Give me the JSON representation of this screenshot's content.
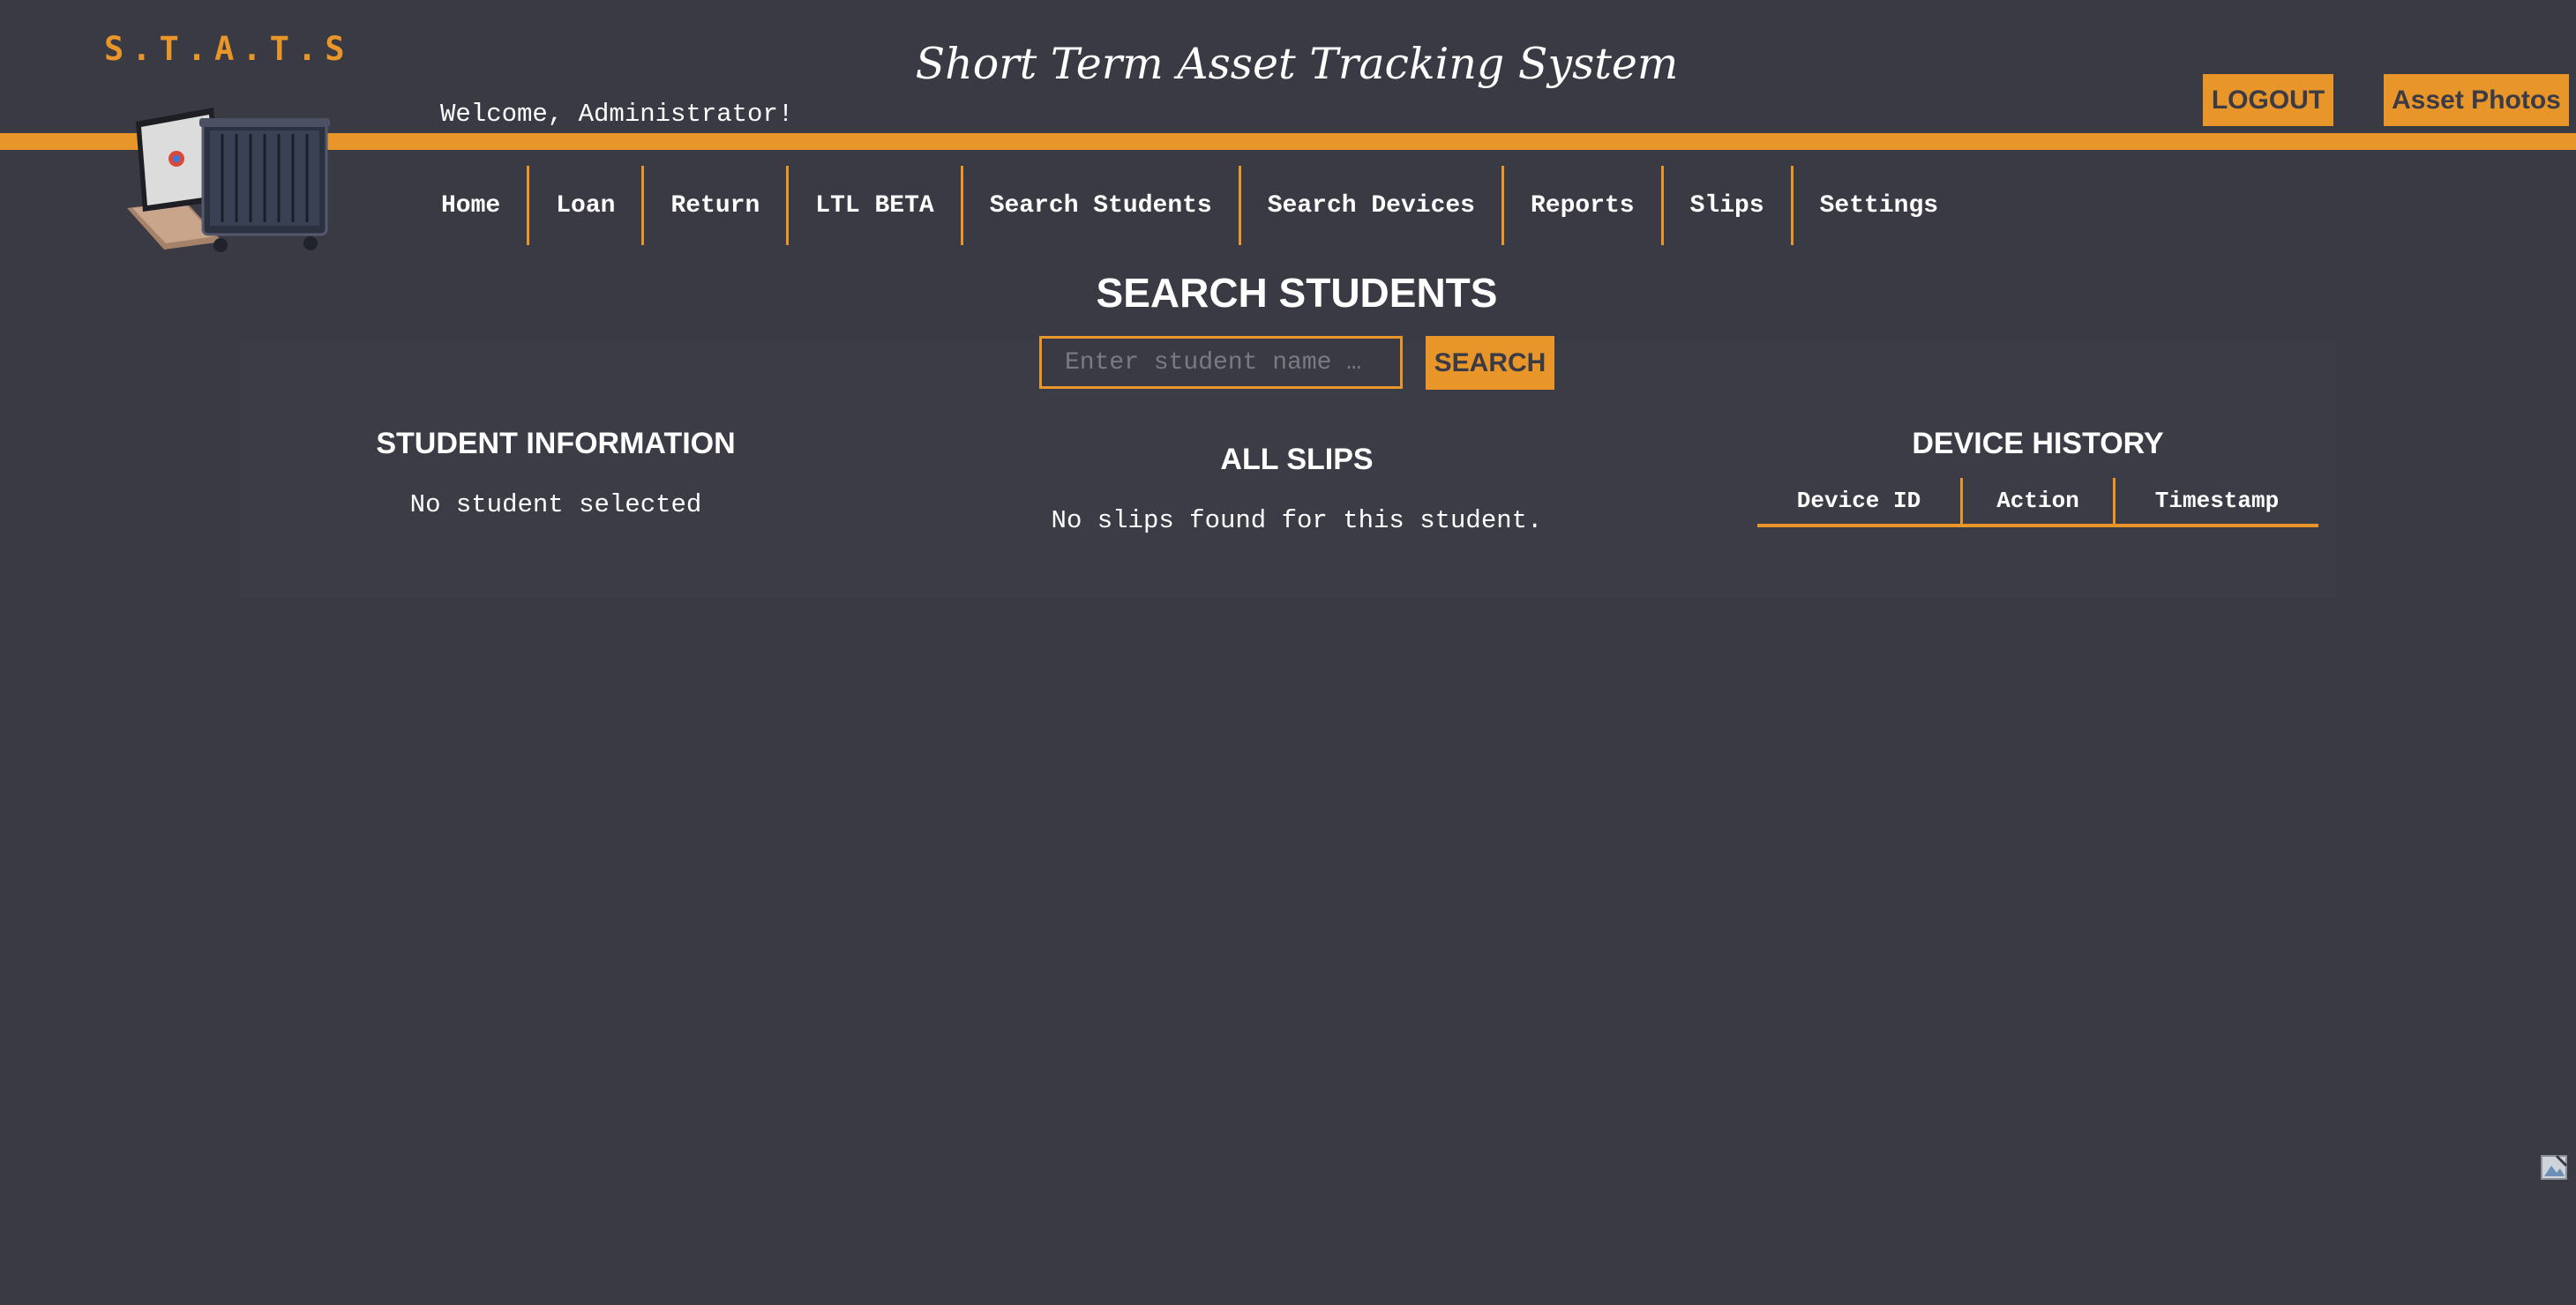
{
  "header": {
    "logo_text": "S.T.A.T.S",
    "title": "Short Term Asset Tracking System",
    "welcome": "Welcome, Administrator!",
    "logout_label": "LOGOUT",
    "asset_photos_label": "Asset Photos"
  },
  "nav": {
    "items": [
      {
        "label": "Home"
      },
      {
        "label": "Loan"
      },
      {
        "label": "Return"
      },
      {
        "label": "LTL BETA"
      },
      {
        "label": "Search Students"
      },
      {
        "label": "Search Devices"
      },
      {
        "label": "Reports"
      },
      {
        "label": "Slips"
      },
      {
        "label": "Settings"
      }
    ]
  },
  "search": {
    "title": "SEARCH STUDENTS",
    "placeholder": "Enter student name …",
    "button_label": "SEARCH"
  },
  "student_info": {
    "title": "STUDENT INFORMATION",
    "message": "No student selected"
  },
  "slips": {
    "title": "ALL SLIPS",
    "message": "No slips found for this student."
  },
  "device_history": {
    "title": "DEVICE HISTORY",
    "columns": [
      "Device ID",
      "Action",
      "Timestamp"
    ]
  },
  "colors": {
    "accent": "#e8962a",
    "background": "#393a43"
  }
}
